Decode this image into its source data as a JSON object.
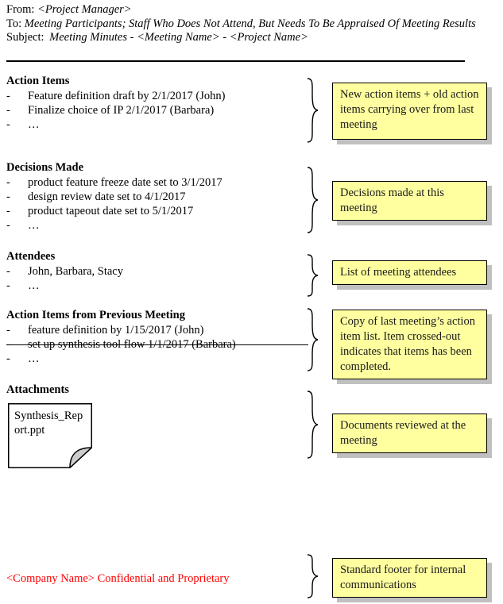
{
  "document": {
    "header": {
      "from_label": "From:",
      "from_value": "<Project Manager>",
      "to_label": "To:",
      "to_value": "Meeting Participants; Staff Who Does Not Attend, But Needs To Be Appraised Of Meeting Results",
      "subject_label": "Subject:",
      "subject_value": "Meeting Minutes - <Meeting Name> - <Project Name>"
    },
    "sections": [
      {
        "title": "Action Items",
        "bullets": [
          {
            "dash": "-",
            "text": "Feature definition draft by 2/1/2017 (John)",
            "struck": false
          },
          {
            "dash": "-",
            "text": "Finalize choice of IP 2/1/2017 (Barbara)",
            "struck": false
          },
          {
            "dash": "-",
            "text": "…",
            "struck": false
          }
        ]
      },
      {
        "title": "Decisions Made",
        "bullets": [
          {
            "dash": "-",
            "text": "product feature freeze date set to 3/1/2017",
            "struck": false
          },
          {
            "dash": "-",
            "text": "design review date set to 4/1/2017",
            "struck": false
          },
          {
            "dash": "-",
            "text": "product tapeout date set to 5/1/2017",
            "struck": false
          },
          {
            "dash": "-",
            "text": "…",
            "struck": false
          }
        ]
      },
      {
        "title": "Attendees",
        "bullets": [
          {
            "dash": "-",
            "text": "John, Barbara, Stacy",
            "struck": false
          },
          {
            "dash": "-",
            "text": "…",
            "struck": false
          }
        ]
      },
      {
        "title": "Action Items from Previous Meeting",
        "bullets": [
          {
            "dash": "-",
            "text": "feature definition by 1/15/2017 (John)",
            "struck": false
          },
          {
            "dash": "-",
            "text": "set up synthesis tool flow 1/1/2017 (Barbara)",
            "struck": true
          },
          {
            "dash": "-",
            "text": "…",
            "struck": false
          }
        ]
      },
      {
        "title": "Attachments",
        "bullets": []
      }
    ],
    "attachment": {
      "filename": "Synthesis_Report.ppt"
    },
    "footer": {
      "text": "<Company Name> Confidential and Proprietary",
      "color": "#ff0000"
    },
    "callouts": [
      {
        "text": "New action items + old action items carrying over from last meeting"
      },
      {
        "text": "Decisions made at this meeting"
      },
      {
        "text": "List of meeting attendees"
      },
      {
        "text": "Copy of last meeting’s action item list. Item crossed-out indicates that items has been completed."
      },
      {
        "text": "Documents reviewed at the meeting"
      },
      {
        "text": "Standard footer for internal communications"
      }
    ],
    "colors": {
      "note_fill": "#ffffa0",
      "note_border": "#000000",
      "note_shadow": "#c0c0c0",
      "footer_text": "#ff0000",
      "page_background": "#ffffff"
    }
  }
}
